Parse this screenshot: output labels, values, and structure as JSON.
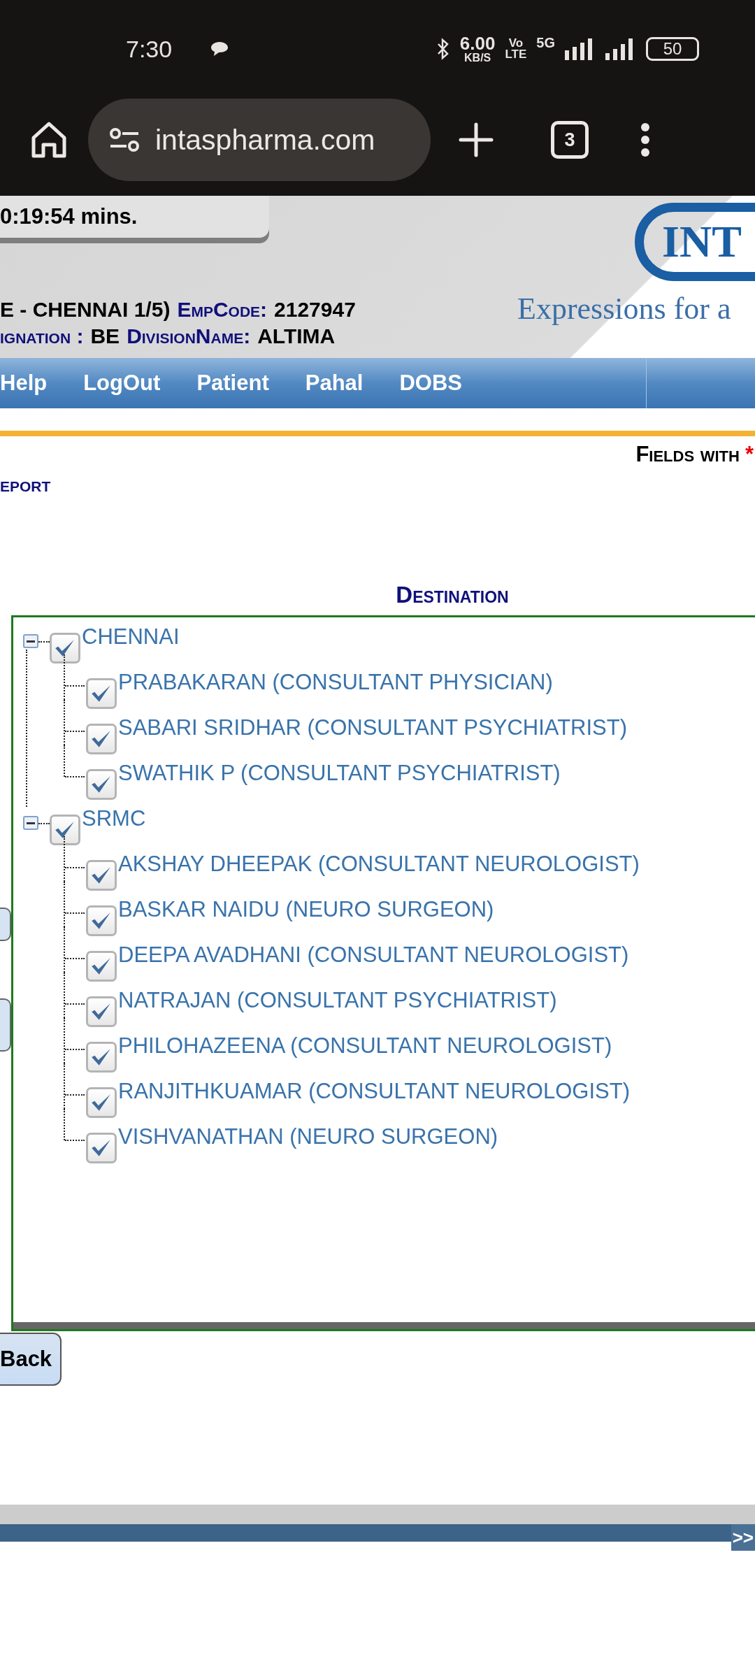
{
  "status_bar": {
    "time": "7:30",
    "net_speed": "6.00",
    "net_unit": "KB/S",
    "volte_top": "Vo",
    "volte_bottom": "LTE",
    "network": "5G",
    "battery": "50"
  },
  "browser": {
    "url": "intaspharma.com",
    "tab_count": "3"
  },
  "header": {
    "timer": "0:19:54 mins.",
    "line1": [
      {
        "text": "E - CHENNAI 1/5)",
        "kind": "value"
      },
      {
        "text": "EmpCode:",
        "kind": "label"
      },
      {
        "text": "2127947",
        "kind": "value"
      }
    ],
    "line2": [
      {
        "text": "ignation :",
        "kind": "label"
      },
      {
        "text": "BE",
        "kind": "value"
      },
      {
        "text": "DivisionName:",
        "kind": "label"
      },
      {
        "text": "ALTIMA",
        "kind": "value"
      }
    ],
    "logo": {
      "name": "INT",
      "tagline": "Expressions for a"
    }
  },
  "nav": [
    {
      "label": "Help"
    },
    {
      "label": "LogOut"
    },
    {
      "label": "Patient"
    },
    {
      "label": "Pahal"
    },
    {
      "label": "DOBS"
    }
  ],
  "notice": {
    "text": "Fields with",
    "mark": "*"
  },
  "section_title": "eport",
  "tree_title": "Destination",
  "tree": [
    {
      "label": "CHENNAI",
      "expanded": true,
      "checked": true,
      "children": [
        {
          "label": "PRABAKARAN (CONSULTANT PHYSICIAN)",
          "checked": true
        },
        {
          "label": "SABARI SRIDHAR (CONSULTANT PSYCHIATRIST)",
          "checked": true
        },
        {
          "label": "SWATHIK P (CONSULTANT PSYCHIATRIST)",
          "checked": true
        }
      ]
    },
    {
      "label": "SRMC",
      "expanded": true,
      "checked": true,
      "children": [
        {
          "label": "AKSHAY DHEEPAK (CONSULTANT NEUROLOGIST)",
          "checked": true
        },
        {
          "label": "BASKAR NAIDU (NEURO SURGEON)",
          "checked": true
        },
        {
          "label": "DEEPA AVADHANI (CONSULTANT NEUROLOGIST)",
          "checked": true
        },
        {
          "label": "NATRAJAN (CONSULTANT PSYCHIATRIST)",
          "checked": true
        },
        {
          "label": "PHILOHAZEENA (CONSULTANT NEUROLOGIST)",
          "checked": true
        },
        {
          "label": "RANJITHKUAMAR (CONSULTANT NEUROLOGIST)",
          "checked": true
        },
        {
          "label": "VISHVANATHAN (NEURO SURGEON)",
          "checked": true
        }
      ]
    }
  ],
  "back_button": "Back",
  "footer": {
    "next": ">>"
  }
}
